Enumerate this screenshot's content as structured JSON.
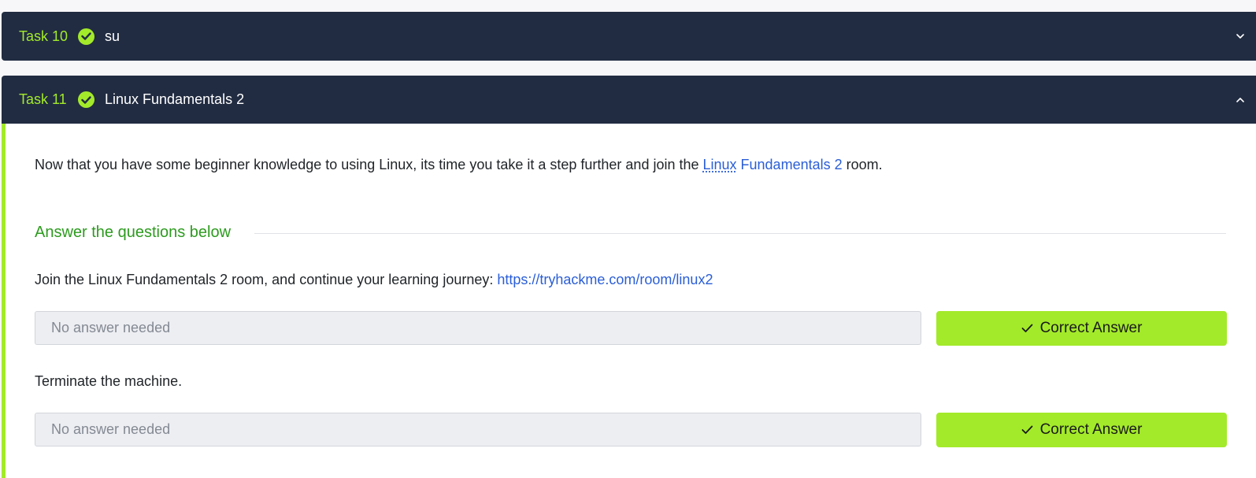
{
  "tasks": [
    {
      "number": "Task 10",
      "title": "su",
      "expanded": false
    },
    {
      "number": "Task 11",
      "title": "Linux Fundamentals 2",
      "expanded": true,
      "description": {
        "prefix": "Now that you have some beginner knowledge to using Linux, its time you take it a step further and join the ",
        "link_abbr": "Linux",
        "link_rest": " Fundamentals 2",
        "suffix": " room."
      },
      "answer_heading": "Answer the questions below",
      "questions": [
        {
          "text": "Join the Linux Fundamentals 2 room, and continue your learning journey: ",
          "link": "https://tryhackme.com/room/linux2",
          "answer_value": "No answer needed",
          "button_label": "Correct Answer"
        },
        {
          "text": "Terminate the machine.",
          "answer_value": "No answer needed",
          "button_label": "Correct Answer"
        }
      ]
    }
  ],
  "colors": {
    "header_bg": "#212c42",
    "accent_green": "#a3ea2a",
    "heading_green": "#2d9b1f",
    "link_blue": "#2b5ed6"
  },
  "icons": {
    "completed": "check-circle-icon",
    "collapsed": "chevron-down-icon",
    "expanded": "chevron-up-icon",
    "button": "checkmark-icon"
  }
}
